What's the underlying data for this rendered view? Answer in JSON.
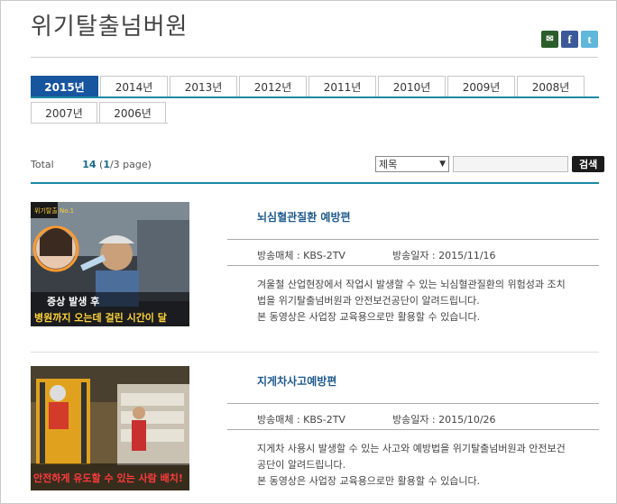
{
  "site": {
    "title": "위기탈출넘버원",
    "social": [
      {
        "name": "message-icon",
        "glyph": "✉"
      },
      {
        "name": "facebook-icon",
        "glyph": "f"
      },
      {
        "name": "twitter-icon",
        "glyph": "t"
      }
    ]
  },
  "tabs": {
    "row1": [
      "2015년",
      "2014년",
      "2013년",
      "2012년",
      "2011년",
      "2010년",
      "2009년",
      "2008년"
    ],
    "row2": [
      "2007년",
      "2006년"
    ],
    "active": "2015년"
  },
  "toolbar": {
    "total_label": "Total",
    "total_count": "14",
    "page_current": "1",
    "page_suffix": "/3 page)",
    "page_prefix": "(",
    "select_value": "제목",
    "search_button": "검색"
  },
  "items": [
    {
      "title": "뇌심혈관질환 예방편",
      "media_label": "방송매체 : KBS-2TV",
      "date_label": "방송일자 : 2015/11/16",
      "desc": [
        "겨울철 산업현장에서 작업시 발생할 수 있는 뇌심혈관질환의 위험성과 조치",
        "법을 위기탈출넘버원과 안전보건공단이 알려드립니다.",
        "본 동영상은 사업장 교육용으로만 활용할 수 있습니다."
      ],
      "thumb_caption1": "증상 발생 후",
      "thumb_caption2": "병원까지 오는데 걸린 시간이 달",
      "thumb_logo": "위기탈출 No.1"
    },
    {
      "title": "지게차사고예방편",
      "media_label": "방송매체 : KBS-2TV",
      "date_label": "방송일자 : 2015/10/26",
      "desc": [
        "지게차 사용시 발생할 수 있는 사고와 예방법을 위기탈출넘버원과 안전보건",
        "공단이 알려드립니다.",
        "본 동영상은 사업장 교육용으로만 활용할 수 있습니다."
      ],
      "thumb_caption1": "안전하게 유도할 수 있는 사람 배치!"
    }
  ]
}
